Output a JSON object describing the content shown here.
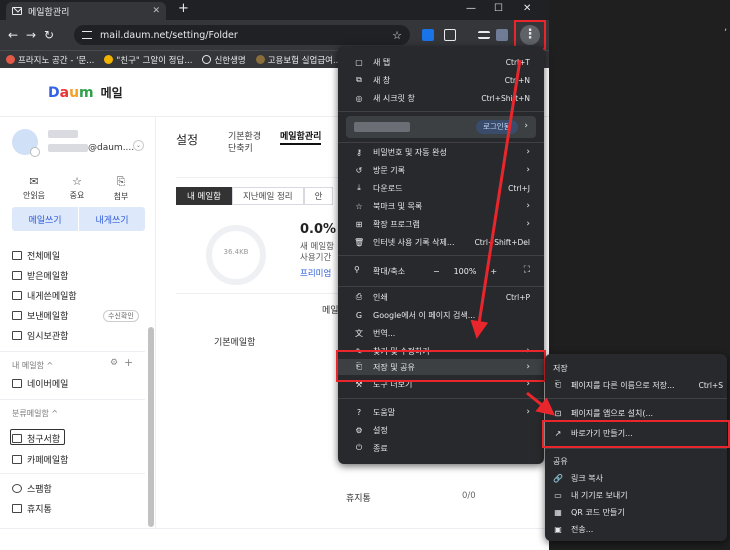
{
  "browser": {
    "tab_title": "메일함관리",
    "tab_close": "✕",
    "new_tab": "+",
    "win_min": "—",
    "win_max": "☐",
    "win_close": "✕",
    "url": "mail.daum.net/setting/Folder",
    "nav_back": "←",
    "nav_forward": "→",
    "nav_reload": "↻",
    "star": "☆",
    "menu_icon": "⋮",
    "bookmarks": [
      {
        "label": "프라지노 공간 - '문...",
        "color": "#e05a47"
      },
      {
        "label": "\"친구\" 그알이 정답...",
        "color": "#f0b400"
      },
      {
        "label": "신한생명",
        "color": "#e8eaed"
      },
      {
        "label": "고용보험 실업급여...",
        "color": "#8a6d3b"
      }
    ]
  },
  "daum": {
    "logo": [
      "D",
      "a",
      "u",
      "m"
    ],
    "logo_suffix": "메일",
    "account_domain": "@daum....",
    "quick": [
      {
        "icon": "✉",
        "label": "안읽음"
      },
      {
        "icon": "☆",
        "label": "중요"
      },
      {
        "icon": "⎘",
        "label": "첨부"
      }
    ],
    "write_label": "메일쓰기",
    "self_write_label": "내게쓰기",
    "folders": [
      "전체메일",
      "받은메일함",
      "내게쓴메일함",
      "보낸메일함",
      "임시보관함"
    ],
    "sent_badge": "수신확인",
    "my_folders_header": "내 메일함 ^",
    "my_folders": [
      "네이버메일"
    ],
    "category_header": "분류메일함 ^",
    "category_folders": [
      "청구서함",
      "카페메일함"
    ],
    "extra_folders": [
      "스팸함",
      "휴지통"
    ]
  },
  "settings": {
    "title": "설정",
    "tabs": [
      "기본환경\n단축키",
      "메일함관리"
    ],
    "sub_tabs": [
      "내 메일함",
      "지난메일 정리",
      "안"
    ],
    "usage_ring": "36.4KB",
    "usage_pct": "0.0%",
    "usage_lines": [
      "새 메일함",
      "사용기간"
    ],
    "premium_link": "프리미엄",
    "col_header": "메일",
    "basic_row": "기본메일함",
    "trash_row": "휴지통",
    "trash_value": "0/0"
  },
  "chrome_menu": {
    "items_top": [
      {
        "icon": "▢",
        "label": "새 탭",
        "shortcut": "Ctrl+T"
      },
      {
        "icon": "⧉",
        "label": "새 창",
        "shortcut": "Ctrl+N"
      },
      {
        "icon": "◎",
        "label": "새 시크릿 창",
        "shortcut": "Ctrl+Shift+N"
      }
    ],
    "profile_login": "로그인됨",
    "items_mid": [
      {
        "icon": "⚷",
        "label": "비밀번호 및 자동 완성",
        "arrow": "›"
      },
      {
        "icon": "↺",
        "label": "방문 기록",
        "arrow": "›"
      },
      {
        "icon": "⤓",
        "label": "다운로드",
        "shortcut": "Ctrl+J"
      },
      {
        "icon": "☆",
        "label": "북마크 및 목록",
        "arrow": "›"
      },
      {
        "icon": "⊞",
        "label": "확장 프로그램",
        "arrow": "›"
      },
      {
        "icon": "🗑",
        "label": "인터넷 사용 기록 삭제...",
        "shortcut": "Ctrl+Shift+Del"
      }
    ],
    "zoom_label": "확대/축소",
    "zoom_minus": "−",
    "zoom_value": "100%",
    "zoom_plus": "+",
    "fullscreen": "⛶",
    "items_low": [
      {
        "icon": "⎙",
        "label": "인쇄",
        "shortcut": "Ctrl+P"
      },
      {
        "icon": "G",
        "label": "Google에서 이 페이지 검색..."
      },
      {
        "icon": "文",
        "label": "번역..."
      },
      {
        "icon": "✎",
        "label": "찾기 및 수정하기",
        "arrow": "›"
      },
      {
        "icon": "⎗",
        "label": "저장 및 공유",
        "arrow": "›"
      },
      {
        "icon": "⚒",
        "label": "도구 더보기",
        "arrow": "›"
      }
    ],
    "items_bottom": [
      {
        "icon": "?",
        "label": "도움말",
        "arrow": "›"
      },
      {
        "icon": "⚙",
        "label": "설정"
      },
      {
        "icon": "⏻",
        "label": "종료"
      }
    ]
  },
  "save_share_menu": {
    "save_header": "저장",
    "save_items": [
      {
        "icon": "⎗",
        "label": "페이지를 다른 이름으로 저장...",
        "shortcut": "Ctrl+S"
      },
      {
        "icon": "⊡",
        "label": "페이지를 앱으로 설치(..."
      },
      {
        "icon": "↗",
        "label": "바로가기 만들기..."
      }
    ],
    "share_header": "공유",
    "share_items": [
      {
        "icon": "🔗",
        "label": "링크 복사"
      },
      {
        "icon": "▭",
        "label": "내 기기로 보내기"
      },
      {
        "icon": "▦",
        "label": "QR 코드 만들기"
      },
      {
        "icon": "▣",
        "label": "전송..."
      }
    ]
  },
  "annotation_color": "#e8262c"
}
